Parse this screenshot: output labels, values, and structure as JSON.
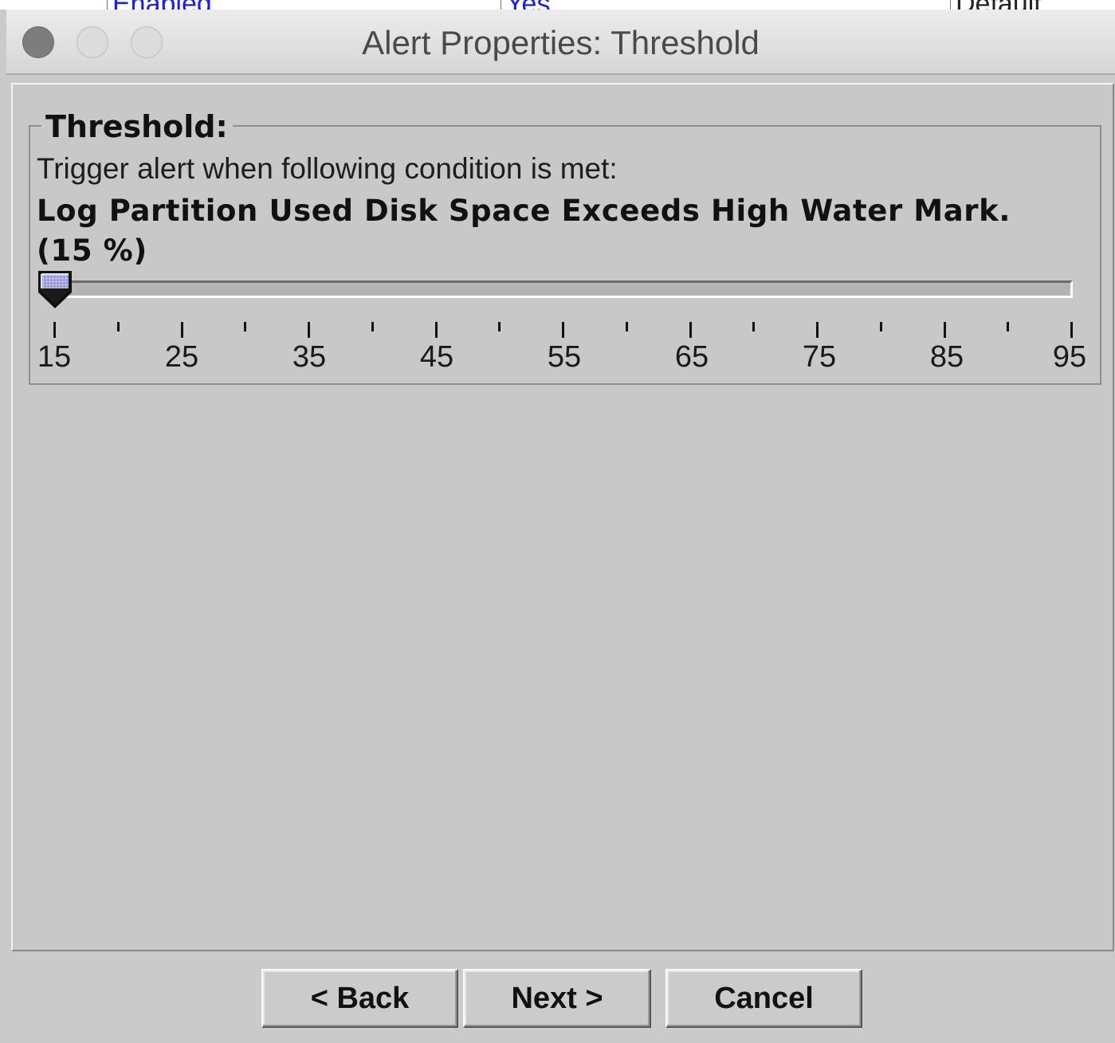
{
  "background_window": {
    "cells": [
      "Enabled",
      "Yes",
      "Default"
    ]
  },
  "window": {
    "title": "Alert Properties: Threshold"
  },
  "threshold_group": {
    "title": "Threshold:",
    "instruction": "Trigger alert when following condition is met:",
    "condition": "Log Partition Used Disk Space Exceeds High Water Mark. (15 %)"
  },
  "slider": {
    "value": 15,
    "min": 15,
    "max": 95,
    "major_tick_spacing": 10,
    "minor_tick_spacing": 5,
    "tick_labels": [
      "15",
      "25",
      "35",
      "45",
      "55",
      "65",
      "75",
      "85",
      "95"
    ]
  },
  "buttons": {
    "back": "< Back",
    "next": "Next >",
    "cancel": "Cancel"
  },
  "colors": {
    "thumb_fill": "#a8a8e6",
    "thumb_border": "#1a1a1a",
    "background_link": "#1a1aff"
  },
  "icons": {
    "close": "close-circle-icon",
    "minimize": "minimize-circle-icon",
    "zoom": "zoom-circle-icon",
    "slider_thumb": "slider-pointer-icon"
  }
}
